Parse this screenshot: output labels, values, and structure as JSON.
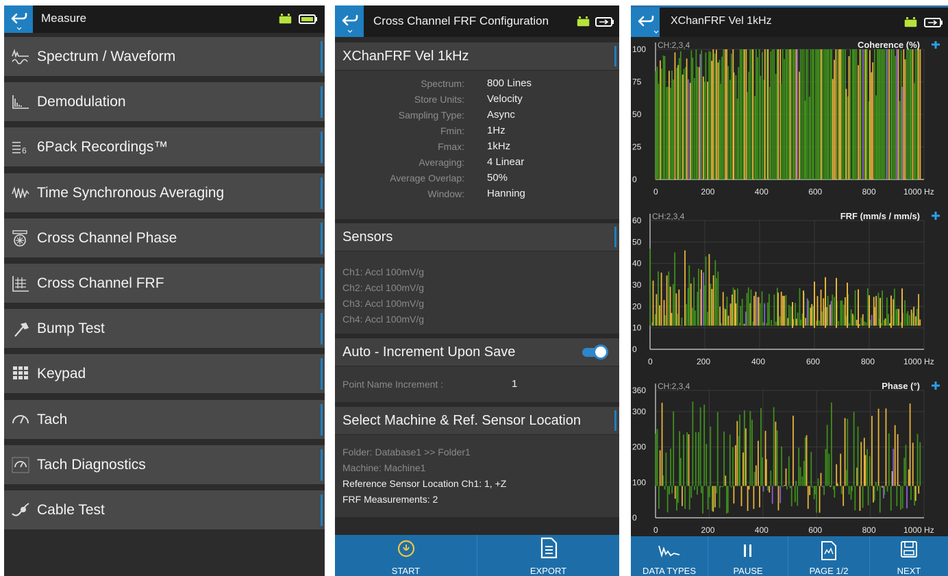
{
  "measure_panel": {
    "title": "Measure",
    "items": [
      {
        "label": "Spectrum / Waveform",
        "icon": "spectrum-waveform-icon"
      },
      {
        "label": "Demodulation",
        "icon": "demodulation-icon"
      },
      {
        "label": "6Pack Recordings™",
        "icon": "six-pack-icon"
      },
      {
        "label": "Time Synchronous Averaging",
        "icon": "tsa-icon"
      },
      {
        "label": "Cross Channel Phase",
        "icon": "cross-channel-phase-icon"
      },
      {
        "label": "Cross Channel FRF",
        "icon": "cross-channel-frf-icon"
      },
      {
        "label": "Bump Test",
        "icon": "hammer-icon"
      },
      {
        "label": "Keypad",
        "icon": "keypad-icon"
      },
      {
        "label": "Tach",
        "icon": "tach-icon"
      },
      {
        "label": "Tach Diagnostics",
        "icon": "tach-diagnostics-icon"
      },
      {
        "label": "Cable Test",
        "icon": "cable-test-icon"
      }
    ]
  },
  "config_panel": {
    "title": "Cross Channel FRF Configuration",
    "measurement": {
      "heading": "XChanFRF Vel 1kHz",
      "rows": [
        {
          "label": "Spectrum:",
          "value": "800 Lines"
        },
        {
          "label": "Store Units:",
          "value": "Velocity"
        },
        {
          "label": "Sampling Type:",
          "value": "Async"
        },
        {
          "label": "Fmin:",
          "value": "1Hz"
        },
        {
          "label": "Fmax:",
          "value": "1kHz"
        },
        {
          "label": "Averaging:",
          "value": "4 Linear"
        },
        {
          "label": "Average Overlap:",
          "value": "50%"
        },
        {
          "label": "Window:",
          "value": "Hanning"
        }
      ]
    },
    "sensors": {
      "heading": "Sensors",
      "lines": [
        "Ch1: Accl 100mV/g",
        "Ch2: Accl 100mV/g",
        "Ch3: Accl 100mV/g",
        "Ch4: Accl 100mV/g"
      ]
    },
    "auto_increment": {
      "heading": "Auto - Increment Upon Save",
      "toggle_on": true,
      "label": "Point Name Increment :",
      "value": "1"
    },
    "machine": {
      "heading": "Select Machine & Ref. Sensor Location",
      "folder": "Folder: Database1 >> Folder1",
      "machine": "Machine: Machine1",
      "reference": "Reference Sensor Location Ch1: 1, +Z",
      "frf_measurements": "FRF Measurements: 2"
    },
    "buttons": {
      "start": "START",
      "export": "EXPORT"
    }
  },
  "plot_panel": {
    "title": "XChanFRF Vel 1kHz",
    "buttons": {
      "data_types": "DATA TYPES",
      "pause": "PAUSE",
      "page": "PAGE 1/2",
      "next": "NEXT"
    },
    "colors": {
      "green": "#3f8f1c",
      "yellow": "#e8b53a",
      "purple": "#8a5fd0",
      "accent": "#2aa0e8"
    }
  },
  "chart_data": [
    {
      "type": "line",
      "title": "Coherence (%)",
      "channels": "CH:2,3,4",
      "ylim": [
        0,
        100
      ],
      "yticks": [
        0,
        25,
        50,
        75,
        100
      ],
      "xlim": [
        0,
        1000
      ],
      "xticks": [
        "0",
        "200",
        "400",
        "600",
        "800",
        "1000 Hz"
      ],
      "grid": true
    },
    {
      "type": "line",
      "title": "FRF (mm/s / mm/s)",
      "channels": "CH:2,3,4",
      "ylim": [
        0,
        60
      ],
      "yticks": [
        0,
        10,
        20,
        30,
        40,
        50,
        60
      ],
      "xlim": [
        0,
        1000
      ],
      "xticks": [
        "0",
        "200",
        "400",
        "600",
        "800",
        "1000 Hz"
      ],
      "grid": true
    },
    {
      "type": "line",
      "title": "Phase (°)",
      "channels": "CH:2,3,4",
      "ylim": [
        0,
        360
      ],
      "yticks": [
        0,
        100,
        200,
        300,
        360
      ],
      "xlim": [
        0,
        1000
      ],
      "xticks": [
        "0",
        "200",
        "400",
        "600",
        "800",
        "1000 Hz"
      ],
      "grid": true
    }
  ]
}
